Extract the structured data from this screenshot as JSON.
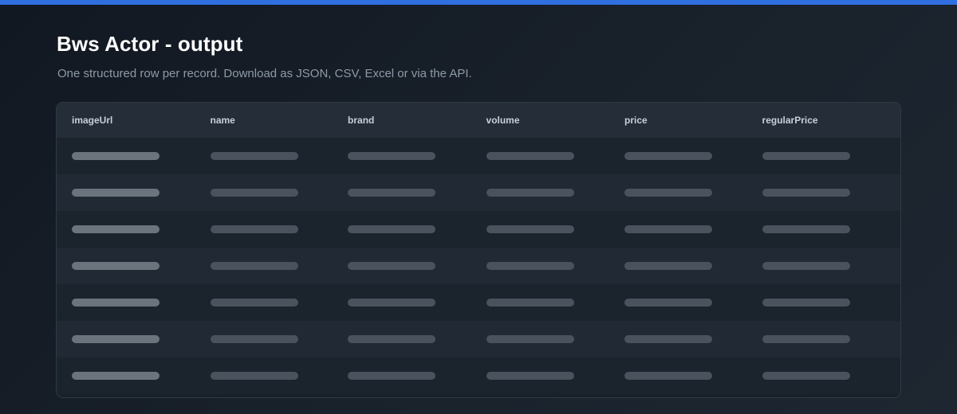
{
  "colors": {
    "accent": "#2f6fe0",
    "background": "#161d26",
    "header_bg": "#252e38"
  },
  "page": {
    "title": "Bws Actor - output",
    "subtitle": "One structured row per record. Download as JSON, CSV, Excel or via the API."
  },
  "table": {
    "columns": [
      "imageUrl",
      "name",
      "brand",
      "volume",
      "price",
      "regularPrice"
    ],
    "row_count": 7,
    "row_state": "loading-placeholder"
  }
}
